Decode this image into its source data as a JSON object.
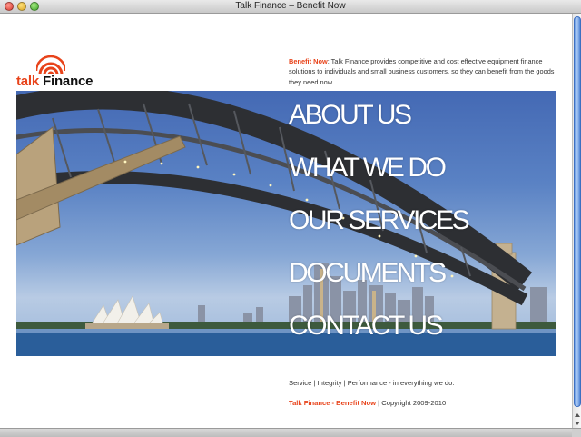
{
  "window": {
    "title": "Talk Finance – Benefit Now"
  },
  "logo": {
    "word1": "talk",
    "word2": "Finance"
  },
  "intro": {
    "lead": "Benefit Now",
    "text": ": Talk Finance provides competitive and cost effective equipment finance solutions to individuals and small business customers, so they can benefit from the goods they need now."
  },
  "nav": {
    "items": [
      "ABOUT US",
      "WHAT WE DO",
      "OUR SERVICES",
      "DOCUMENTS",
      "CONTACT US"
    ]
  },
  "footer": {
    "tagline": "Service | Integrity | Performance - in everything we do.",
    "copyright_link": "Talk Finance - Benefit Now",
    "copyright_text": " | Copyright 2009-2010"
  },
  "colors": {
    "accent": "#e8431a",
    "sky": "#5a82c4",
    "scroll_thumb": "#6fa0e6"
  }
}
